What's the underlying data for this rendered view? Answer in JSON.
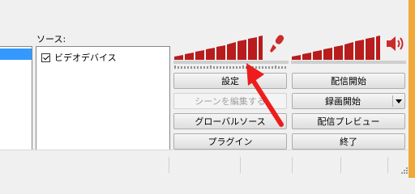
{
  "sources": {
    "label": "ソース:",
    "items": [
      {
        "label": "ビデオデバイス",
        "checked": true
      }
    ]
  },
  "meters": {
    "mic": {
      "icon": "microphone-icon",
      "level": 0.82
    },
    "desktop": {
      "icon": "speaker-icon",
      "level": 0.82
    }
  },
  "buttons": {
    "settings": "設定",
    "edit_scene": "シーンを編集する",
    "global_sources": "グローバルソース",
    "plugins": "プラグイン",
    "start_streaming": "配信開始",
    "start_recording": "録画開始",
    "preview_stream": "配信プレビュー",
    "exit": "終了"
  },
  "colors": {
    "meter_bar": "#b81c1c",
    "icon_red": "#cc2b2b",
    "annotation_arrow": "#ee1c1c",
    "list_selection": "#3399ff",
    "window_frame": "#f0a836"
  }
}
